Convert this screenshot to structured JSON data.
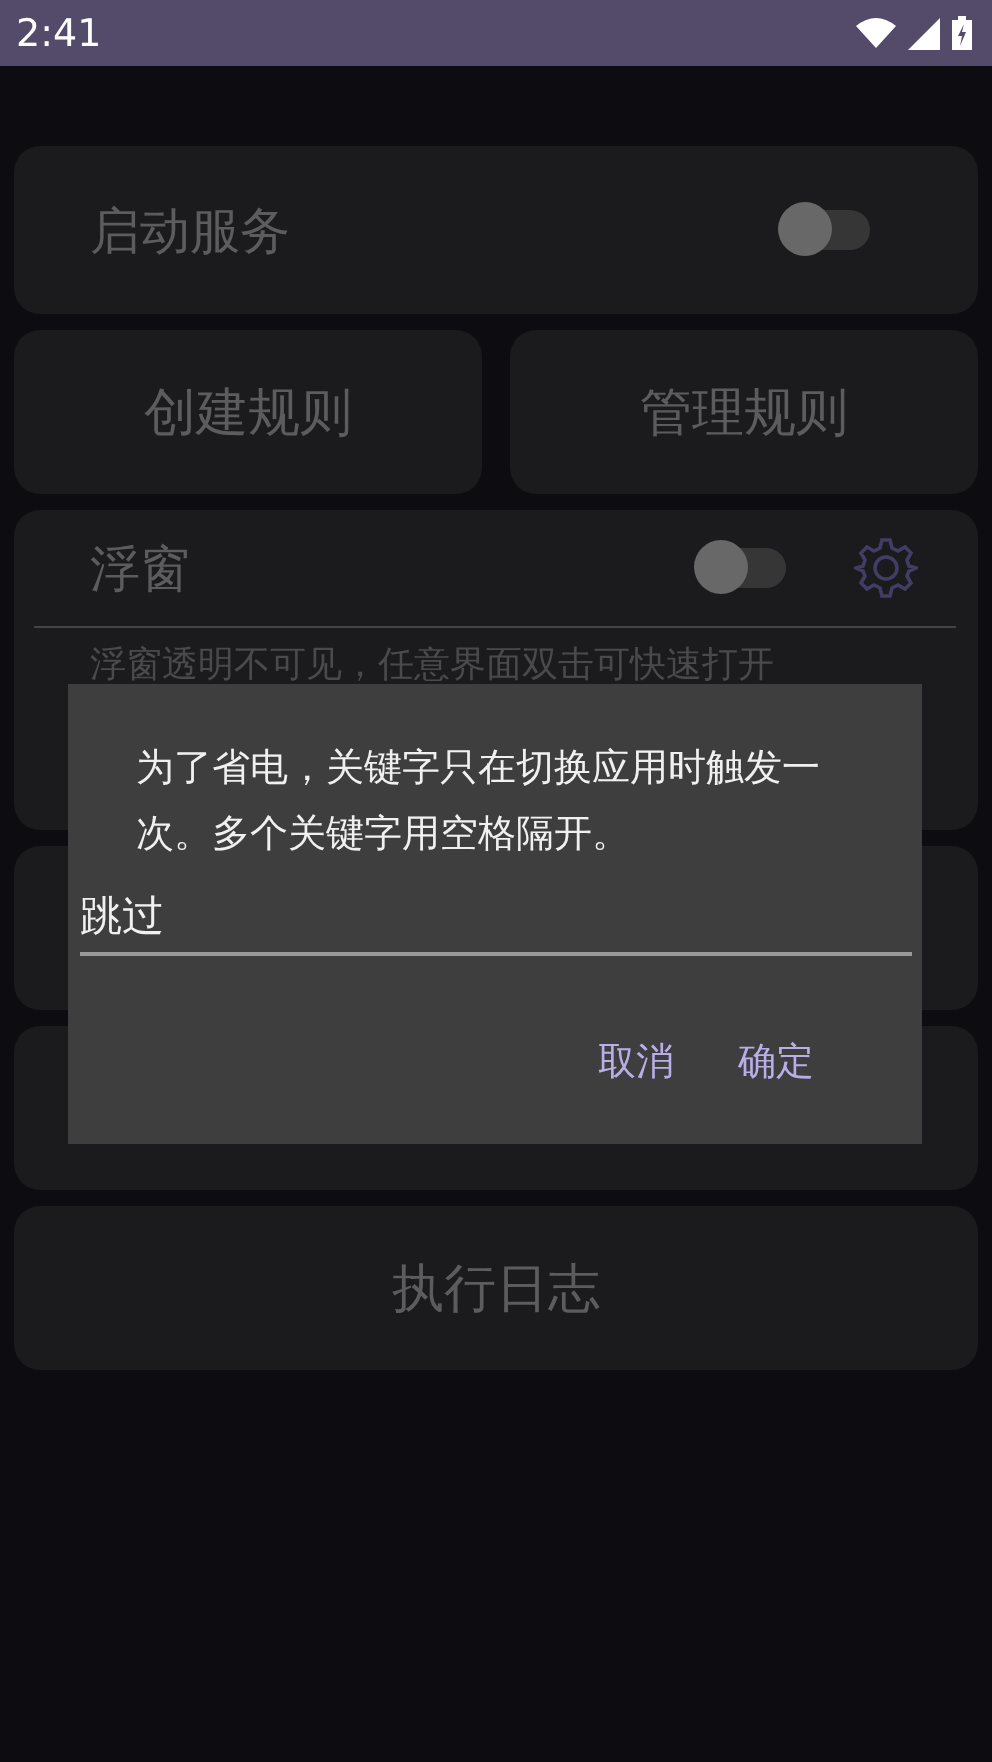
{
  "status_bar": {
    "time": "2:41"
  },
  "service": {
    "label": "启动服务",
    "on": false
  },
  "rule_buttons": [
    "创建规则",
    "管理规则"
  ],
  "floating_window": {
    "label": "浮窗",
    "on": false,
    "hint": "浮窗透明不可见，任意界面双击可快速打开"
  },
  "log_button": "执行日志",
  "dialog": {
    "message": "为了省电，关键字只在切换应用时触发一次。多个关键字用空格隔开。",
    "value": "跳过",
    "buttons": [
      "取消",
      "确定"
    ]
  }
}
